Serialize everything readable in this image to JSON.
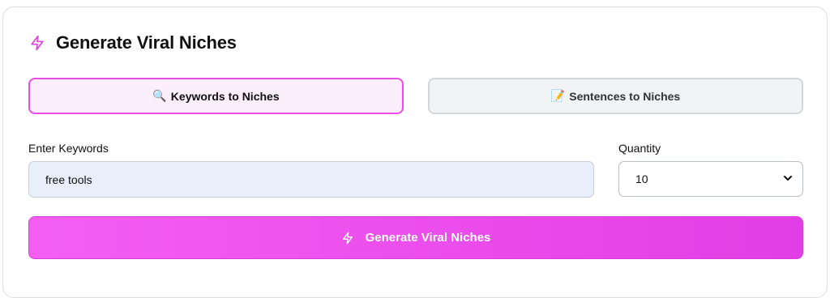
{
  "header": {
    "title": "Generate Viral Niches",
    "icon": "lightning-icon",
    "accent_color": "#e040e0"
  },
  "tabs": [
    {
      "label": "Keywords to Niches",
      "icon": "magnifier-emoji-icon",
      "emoji": "🔍",
      "active": true
    },
    {
      "label": "Sentences to Niches",
      "icon": "memo-emoji-icon",
      "emoji": "📝",
      "active": false
    }
  ],
  "form": {
    "keywords_label": "Enter Keywords",
    "keywords_value": "free tools",
    "quantity_label": "Quantity",
    "quantity_value": "10"
  },
  "generate_button": {
    "label": "Generate Viral Niches",
    "icon": "lightning-icon"
  }
}
